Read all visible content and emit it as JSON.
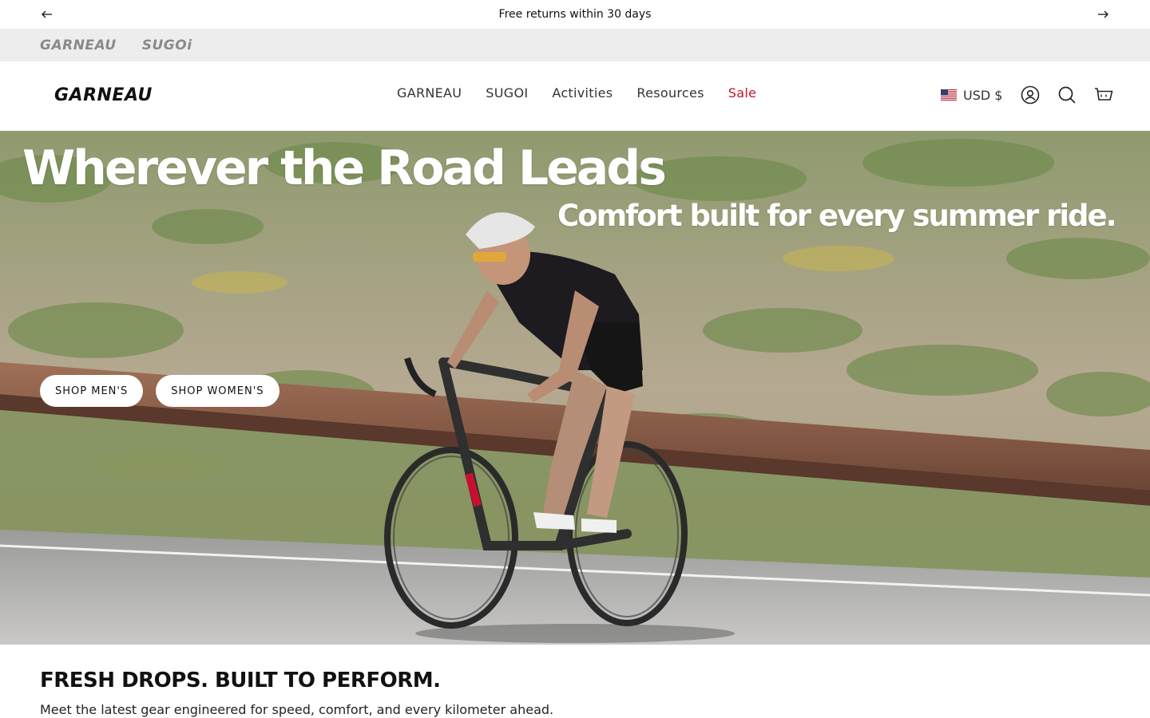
{
  "announcement": {
    "message": "Free returns within 30 days",
    "prev_icon": "arrow-left-icon",
    "next_icon": "arrow-right-icon"
  },
  "brand_strip": {
    "brands": [
      "GARNEAU",
      "SUGOi"
    ]
  },
  "header": {
    "logo": "GARNEAU",
    "nav": [
      {
        "label": "GARNEAU"
      },
      {
        "label": "SUGOI"
      },
      {
        "label": "Activities"
      },
      {
        "label": "Resources"
      },
      {
        "label": "Sale"
      }
    ],
    "currency": "USD $",
    "icons": [
      "us-flag-icon",
      "account-icon",
      "search-icon",
      "cart-icon"
    ]
  },
  "hero": {
    "headline": "Wherever the Road Leads",
    "subline": "Comfort built for every summer ride.",
    "buttons": {
      "mens": "SHOP MEN'S",
      "womens": "SHOP WOMEN'S"
    }
  },
  "section": {
    "title": "FRESH DROPS. BUILT TO PERFORM.",
    "subtitle": "Meet the latest gear engineered for speed, comfort, and every kilometer ahead."
  },
  "colors": {
    "sale": "#c8102e",
    "brand_strip_bg": "#ededed",
    "text": "#111111"
  }
}
